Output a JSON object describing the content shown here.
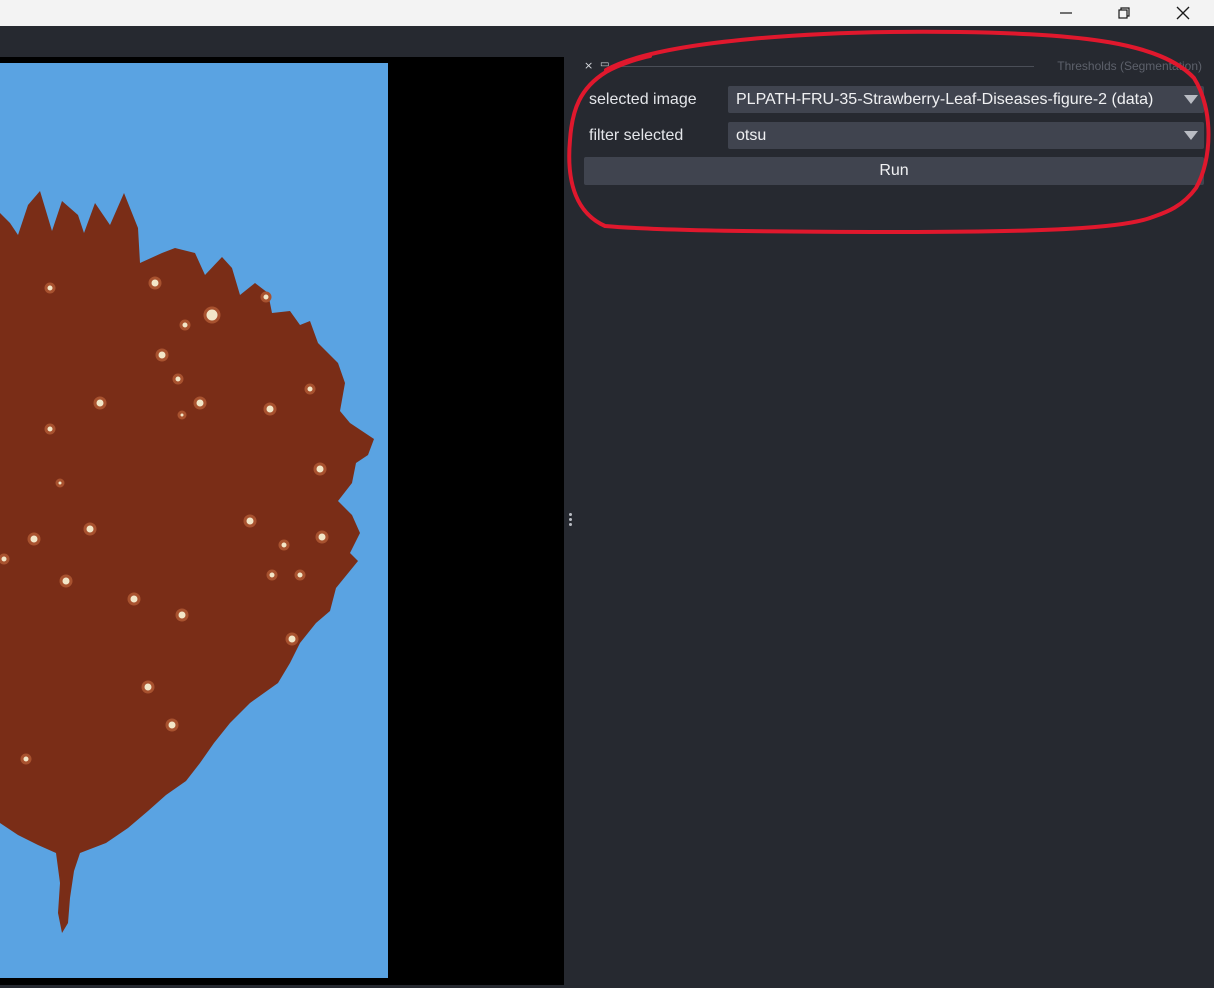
{
  "window": {
    "controls": {
      "minimize_icon": "minimize-icon",
      "restore_icon": "restore-icon",
      "close_icon": "close-icon"
    }
  },
  "dock": {
    "title": "Thresholds (Segmentation)",
    "close_glyph": "×",
    "float_glyph": "▭"
  },
  "form": {
    "selected_image_label": "selected image",
    "selected_image_value": "PLPATH-FRU-35-Strawberry-Leaf-Diseases-figure-2 (data)",
    "filter_label": "filter selected",
    "filter_value": "otsu",
    "run_label": "Run"
  },
  "colors": {
    "panel_bg": "#262930",
    "widget_bg": "#40444f",
    "canvas_bg": "#000000",
    "photo_background": "#5aa3e2",
    "leaf": "#7a2d17",
    "annotation_red": "#e0182d"
  }
}
